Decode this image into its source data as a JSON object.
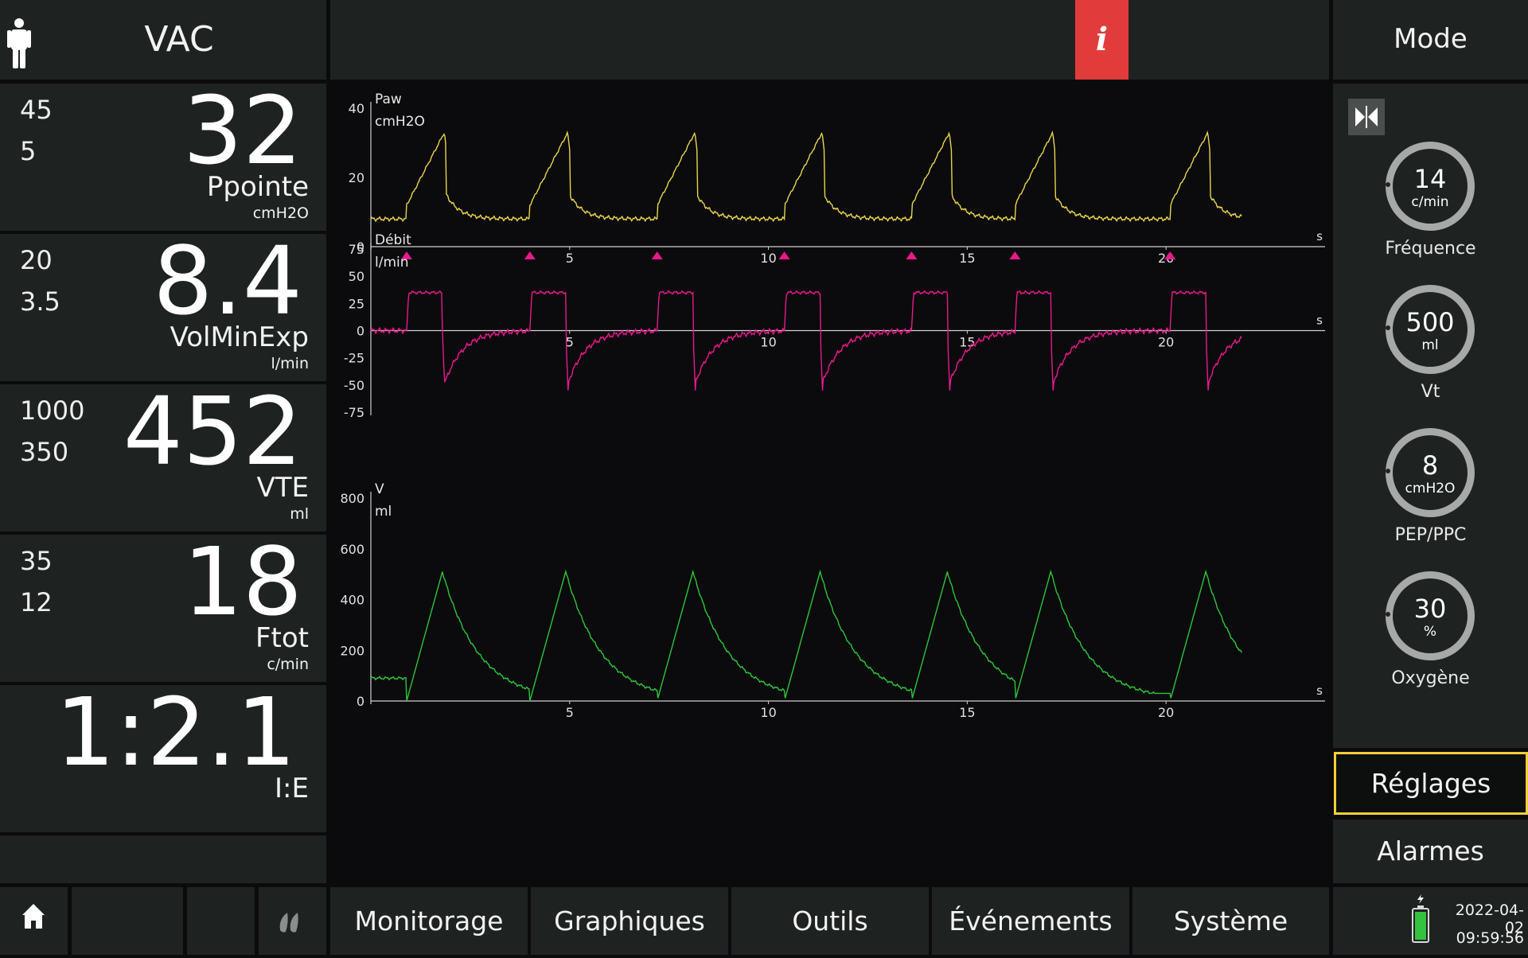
{
  "header": {
    "mode": "VAC",
    "info_icon": "i",
    "mode_button": "Mode",
    "patient_icon": "adult-patient-icon",
    "accent_red": "#e23b3b"
  },
  "monitoring": [
    {
      "limit_high": "45",
      "limit_low": "5",
      "value": "32",
      "name": "Ppointe",
      "unit": "cmH2O"
    },
    {
      "limit_high": "20",
      "limit_low": "3.5",
      "value": "8.4",
      "name": "VolMinExp",
      "unit": "l/min"
    },
    {
      "limit_high": "1000",
      "limit_low": "350",
      "value": "452",
      "name": "VTE",
      "unit": "ml"
    },
    {
      "limit_high": "35",
      "limit_low": "12",
      "value": "18",
      "name": "Ftot",
      "unit": "c/min"
    },
    {
      "value": "1:2.1",
      "name": "I:E"
    }
  ],
  "settings": [
    {
      "value": "14",
      "unit": "c/min",
      "label": "Fréquence"
    },
    {
      "value": "500",
      "unit": "ml",
      "label": "Vt"
    },
    {
      "value": "8",
      "unit": "cmH2O",
      "label": "PEP/PPC"
    },
    {
      "value": "30",
      "unit": "%",
      "label": "Oxygène"
    }
  ],
  "right_buttons": {
    "reglages": "Réglages",
    "alarmes": "Alarmes",
    "selected_color": "#f1cf3a",
    "freeze_icon": "freeze-icon"
  },
  "nav": {
    "home_icon": "home-icon",
    "o2_icon": "lungs-icon",
    "tabs": [
      "Monitorage",
      "Graphiques",
      "Outils",
      "Événements",
      "Système"
    ]
  },
  "status": {
    "date": "2022-04-02",
    "time": "09:59:56",
    "battery_icon": "battery-icon"
  },
  "chart_data": [
    {
      "type": "line",
      "title": "Paw",
      "ylabel": "cmH2O",
      "xlabel": "s",
      "ylim": [
        0,
        40
      ],
      "yticks": [
        0,
        20,
        40
      ],
      "xticks": [
        5,
        10,
        15,
        20
      ],
      "xlim": [
        0,
        24
      ],
      "color": "#e8d44a",
      "breaths": [
        0.9,
        4.0,
        7.2,
        10.4,
        13.6,
        16.2,
        20.1
      ],
      "peak": 33,
      "baseline": 8,
      "trigger_color": "#e8198b"
    },
    {
      "type": "line",
      "title": "Débit",
      "ylabel": "l/min",
      "xlabel": "s",
      "ylim": [
        -75,
        75
      ],
      "yticks": [
        75,
        50,
        25,
        0,
        -25,
        -50,
        -75
      ],
      "xticks": [
        5,
        10,
        15,
        20
      ],
      "xlim": [
        0,
        24
      ],
      "color": "#e8198b",
      "breaths": [
        0.9,
        4.0,
        7.2,
        10.4,
        13.6,
        16.2,
        20.1
      ],
      "insp_flow": 35,
      "exp_peak": -55
    },
    {
      "type": "line",
      "title": "V",
      "ylabel": "ml",
      "xlabel": "s",
      "ylim": [
        0,
        800
      ],
      "yticks": [
        0,
        200,
        400,
        600,
        800
      ],
      "xticks": [
        5,
        10,
        15,
        20
      ],
      "xlim": [
        0,
        24
      ],
      "color": "#2ec43a",
      "breaths": [
        0.9,
        4.0,
        7.2,
        10.4,
        13.6,
        16.2,
        20.1
      ],
      "peak": 510
    }
  ]
}
